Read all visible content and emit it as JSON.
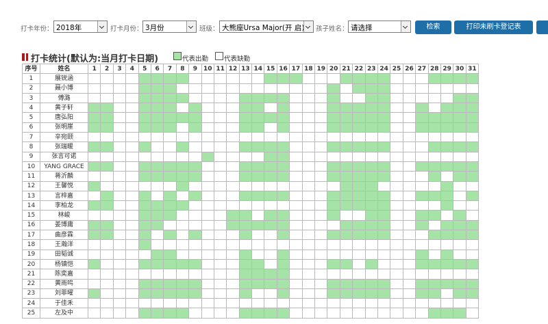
{
  "toolbar": {
    "year_label": "打卡年份：",
    "year_value": "2018年",
    "month_label": "打卡月份：",
    "month_value": "3月份",
    "class_label": "班级：",
    "class_value": "大熊座Ursa Major(开 启)",
    "child_label": "孩子姓名：",
    "child_value": "请选择",
    "search_label": "检索",
    "print_label": "打印未刷卡登记表"
  },
  "stats": {
    "title": "打卡统计(默认为:当月打卡日期)",
    "legend_present": "代表出勤",
    "legend_absent": "代表缺勤",
    "present_color": "#a6e3a6",
    "absent_color": "#ffffff"
  },
  "table": {
    "col_no": "序号",
    "col_name": "姓名",
    "days": [
      "1",
      "2",
      "3",
      "4",
      "5",
      "6",
      "7",
      "8",
      "9",
      "10",
      "11",
      "12",
      "13",
      "14",
      "15",
      "16",
      "17",
      "18",
      "19",
      "20",
      "21",
      "22",
      "23",
      "24",
      "25",
      "26",
      "27",
      "28",
      "29",
      "30",
      "31"
    ],
    "rows": [
      {
        "no": "1",
        "name": "展锐涵",
        "att": "0000111100000011100011110001111"
      },
      {
        "no": "2",
        "name": "聂小博",
        "att": "0000111000000000000101110000000"
      },
      {
        "no": "3",
        "name": "傅潞",
        "att": "0000111100001111000100110000011"
      },
      {
        "no": "4",
        "name": "黄子轩",
        "att": "1100111010001101000111110010111"
      },
      {
        "no": "5",
        "name": "唐弘阳",
        "att": "1100111110001111000111110011111"
      },
      {
        "no": "6",
        "name": "张明崖",
        "att": "1100111010001101000111110011111"
      },
      {
        "no": "7",
        "name": "辛宛颐",
        "att": "0000000000000000000000000000000"
      },
      {
        "no": "8",
        "name": "张瑞暖",
        "att": "1100100100001111000111110001111"
      },
      {
        "no": "9",
        "name": "张言可诺",
        "att": "0000000001000011000000000000000"
      },
      {
        "no": "10",
        "name": "YANG GRACE",
        "att": "1100111110001111000111110011111"
      },
      {
        "no": "11",
        "name": "蒋沂麟",
        "att": "0000111110001111000111110001011"
      },
      {
        "no": "12",
        "name": "王馨悦",
        "att": "1000000100000000000011100000100"
      },
      {
        "no": "13",
        "name": "言梓嘉",
        "att": "0100101010001111000111110011101"
      },
      {
        "no": "14",
        "name": "李柏龙",
        "att": "1100111100000000000111110000100"
      },
      {
        "no": "15",
        "name": "林峻",
        "att": "0000111000011011000100110011010"
      },
      {
        "no": "16",
        "name": "姜博庸",
        "att": "1100110000011111000011110010111"
      },
      {
        "no": "17",
        "name": "曲彦霖",
        "att": "1100101010001001000111110001111"
      },
      {
        "no": "18",
        "name": "王瀚洋",
        "att": "0000100000000000000000000000000"
      },
      {
        "no": "19",
        "name": "田韬诚",
        "att": "0000011000001001000000000010100"
      },
      {
        "no": "20",
        "name": "杨镇恺",
        "att": "1000111110001101000110100011111"
      },
      {
        "no": "21",
        "name": "陈奕嘉",
        "att": "0000000000001111000000000000000"
      },
      {
        "no": "22",
        "name": "黄雨鸣",
        "att": "0000111110001111000111110011111"
      },
      {
        "no": "23",
        "name": "刘菲曜",
        "att": "1000111110001001000111110011011"
      },
      {
        "no": "24",
        "name": "于佳禾",
        "att": "0000000000000000000000000000000"
      },
      {
        "no": "25",
        "name": "左及中",
        "att": "0000111100001111000000000001110"
      }
    ]
  }
}
